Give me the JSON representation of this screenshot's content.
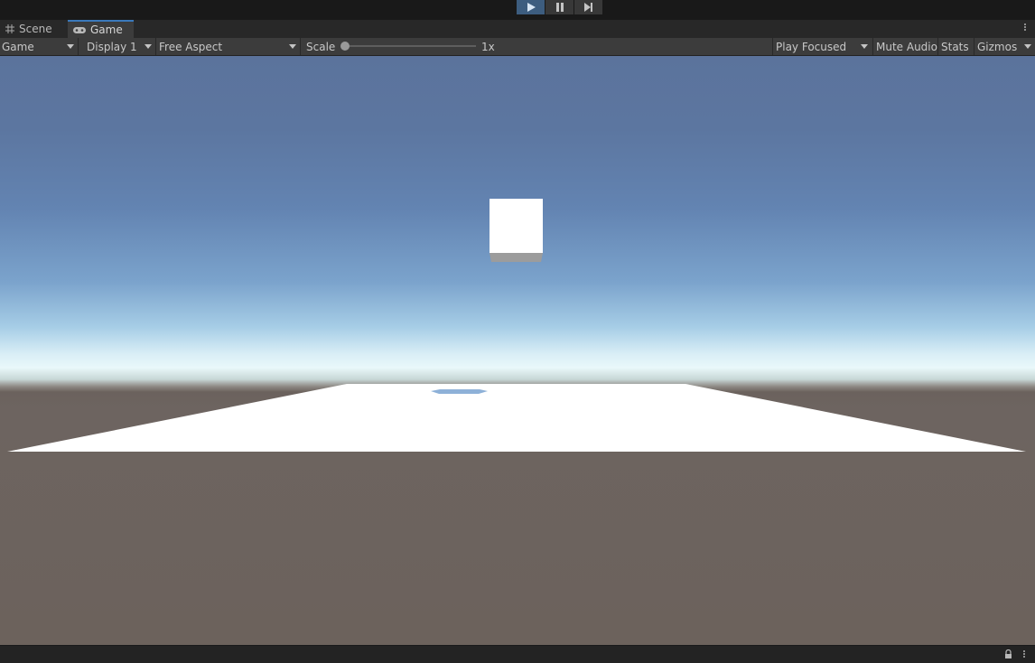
{
  "playbar": {
    "play": "play-icon",
    "pause": "pause-icon",
    "step": "step-icon",
    "active_color": "#3d5d7f"
  },
  "tabs": [
    {
      "label": "Scene",
      "icon": "grid-icon"
    },
    {
      "label": "Game",
      "icon": "gamepad-icon",
      "active": true
    }
  ],
  "toolbar": {
    "view_select": "Game",
    "display_select": "Display 1",
    "aspect_select": "Free Aspect",
    "scale_label": "Scale",
    "scale_value": "1x",
    "play_mode_select": "Play Focused",
    "mute_audio": "Mute Audio",
    "stats": "Stats",
    "gizmos": "Gizmos"
  },
  "scene": {
    "sky_color_top": "#5b739c",
    "horizon_color": "#e9f8fa",
    "ground_color": "#6c625c",
    "cube_color": "#ffffff",
    "plane_color": "#ffffff",
    "shadow_color": "#8eb1d8"
  },
  "statusbar": {
    "lock": "lock-icon",
    "menu": "kebab-menu-icon"
  },
  "accent_color": "#3a79bb"
}
